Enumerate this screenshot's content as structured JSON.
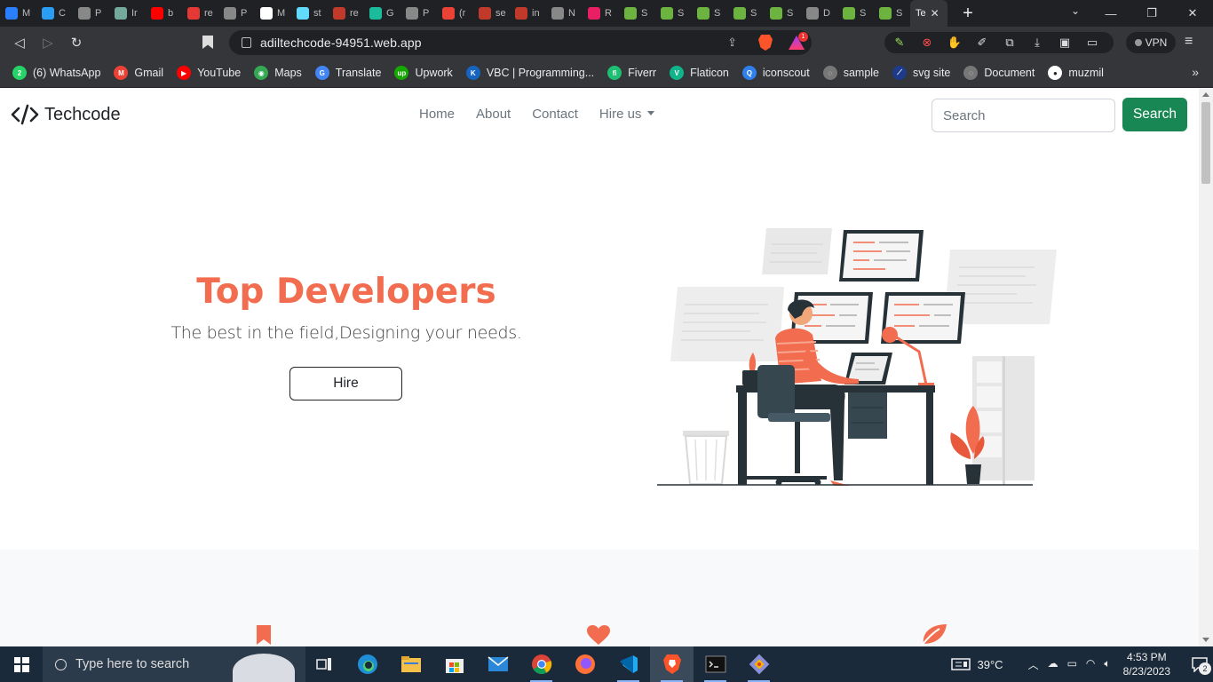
{
  "browser": {
    "tabs": [
      {
        "letter": "M",
        "color": "#2a7fff"
      },
      {
        "letter": "C",
        "color": "#2a9df4"
      },
      {
        "letter": "P",
        "color": "#888888"
      },
      {
        "letter": "Ir",
        "color": "#74aa9c"
      },
      {
        "letter": "b",
        "color": "#ff0000"
      },
      {
        "letter": "re",
        "color": "#e53935"
      },
      {
        "letter": "P",
        "color": "#888888"
      },
      {
        "letter": "M",
        "color": "#ffffff"
      },
      {
        "letter": "st",
        "color": "#61dafb"
      },
      {
        "letter": "re",
        "color": "#c0392b"
      },
      {
        "letter": "G",
        "color": "#1abc9c"
      },
      {
        "letter": "P",
        "color": "#888888"
      },
      {
        "letter": "(r",
        "color": "#ea4335"
      },
      {
        "letter": "se",
        "color": "#c0392b"
      },
      {
        "letter": "in",
        "color": "#c0392b"
      },
      {
        "letter": "N",
        "color": "#888888"
      },
      {
        "letter": "R",
        "color": "#e91e63"
      },
      {
        "letter": "S",
        "color": "#6db33f"
      },
      {
        "letter": "S",
        "color": "#6db33f"
      },
      {
        "letter": "S",
        "color": "#6db33f"
      },
      {
        "letter": "S",
        "color": "#6db33f"
      },
      {
        "letter": "S",
        "color": "#6db33f"
      },
      {
        "letter": "D",
        "color": "#888888"
      },
      {
        "letter": "S",
        "color": "#6db33f"
      },
      {
        "letter": "S",
        "color": "#6db33f"
      }
    ],
    "active_tab": {
      "title": "Te",
      "close": "✕"
    },
    "new_tab": "+",
    "url": "adiltechcode-94951.web.app",
    "rewards_count": "1",
    "vpn_label": "VPN",
    "bookmarks": [
      {
        "label": "(6) WhatsApp",
        "color": "#25d366",
        "glyph": "2"
      },
      {
        "label": "Gmail",
        "color": "#ea4335",
        "glyph": "M"
      },
      {
        "label": "YouTube",
        "color": "#ff0000",
        "glyph": "▶"
      },
      {
        "label": "Maps",
        "color": "#34a853",
        "glyph": "◉"
      },
      {
        "label": "Translate",
        "color": "#4285f4",
        "glyph": "G"
      },
      {
        "label": "Upwork",
        "color": "#14a800",
        "glyph": "up"
      },
      {
        "label": "VBC | Programming...",
        "color": "#1565c0",
        "glyph": "K"
      },
      {
        "label": "Fiverr",
        "color": "#1dbf73",
        "glyph": "fi"
      },
      {
        "label": "Flaticon",
        "color": "#0fb58a",
        "glyph": "V"
      },
      {
        "label": "iconscout",
        "color": "#2f80ed",
        "glyph": "Q"
      },
      {
        "label": "sample",
        "color": "#777777",
        "glyph": "◌"
      },
      {
        "label": "svg site",
        "color": "#1e3a8a",
        "glyph": "⟋"
      },
      {
        "label": "Document",
        "color": "#777777",
        "glyph": "◌"
      },
      {
        "label": "muzmil",
        "color": "#ffffff",
        "glyph": "●"
      }
    ]
  },
  "site": {
    "brand": "Techcode",
    "nav": {
      "home": "Home",
      "about": "About",
      "contact": "Contact",
      "hire": "Hire us"
    },
    "search": {
      "placeholder": "Search",
      "button": "Search"
    },
    "hero": {
      "title": "Top Developers",
      "subtitle": "The best in the field,Designing your needs.",
      "cta": "Hire"
    },
    "accent_color": "#f26d4f",
    "button_color": "#198754"
  },
  "taskbar": {
    "search_placeholder": "Type here to search",
    "temperature": "39°C",
    "time": "4:53 PM",
    "date": "8/23/2023",
    "notifications": "2"
  }
}
